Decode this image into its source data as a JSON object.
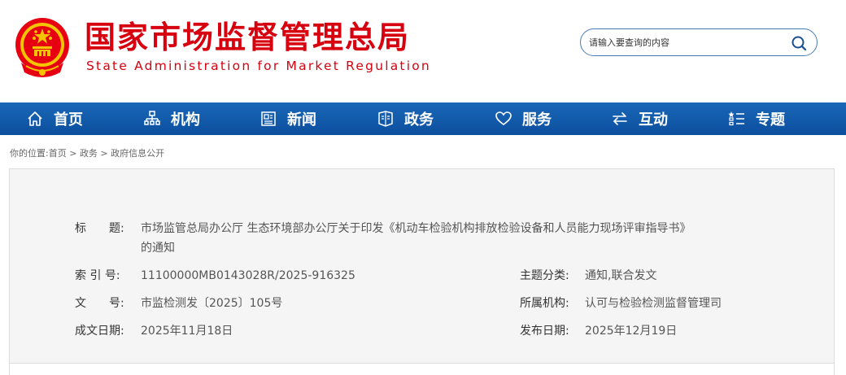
{
  "header": {
    "logo_cn": "国家市场监督管理总局",
    "logo_en": "State Administration for Market Regulation",
    "search_placeholder": "请输入要查询的内容"
  },
  "nav": {
    "items": [
      {
        "label": "首页",
        "icon": "home-icon"
      },
      {
        "label": "机构",
        "icon": "org-chart-icon"
      },
      {
        "label": "新闻",
        "icon": "newspaper-icon"
      },
      {
        "label": "政务",
        "icon": "government-affairs-icon"
      },
      {
        "label": "服务",
        "icon": "heart-icon"
      },
      {
        "label": "互动",
        "icon": "exchange-arrows-icon"
      },
      {
        "label": "专题",
        "icon": "topic-list-icon"
      }
    ]
  },
  "breadcrumb": {
    "prefix": "你的位置:",
    "items": [
      "首页",
      "政务",
      "政府信息公开"
    ],
    "separator": " > "
  },
  "doc_info": {
    "title_label": "标　　题:",
    "title_line1": "市场监管总局办公厅 生态环境部办公厅关于印发《机动车检验机构排放检验设备和人员能力现场评审指导书》",
    "title_line2": "的通知",
    "index_label": "索 引 号:",
    "index_value": "11100000MB0143028R/2025-916325",
    "topic_label": "主题分类:",
    "topic_value": "通知,联合发文",
    "docno_label": "文　　号:",
    "docno_value": "市监检测发〔2025〕105号",
    "agency_label": "所属机构:",
    "agency_value": "认可与检验检测监督管理司",
    "written_label": "成文日期:",
    "written_value": "2025年11月18日",
    "publish_label": "发布日期:",
    "publish_value": "2025年12月19日"
  },
  "colors": {
    "brand_red": "#d7000f",
    "nav_blue": "#0c4f9e",
    "box_bg": "#f5f5f5"
  }
}
